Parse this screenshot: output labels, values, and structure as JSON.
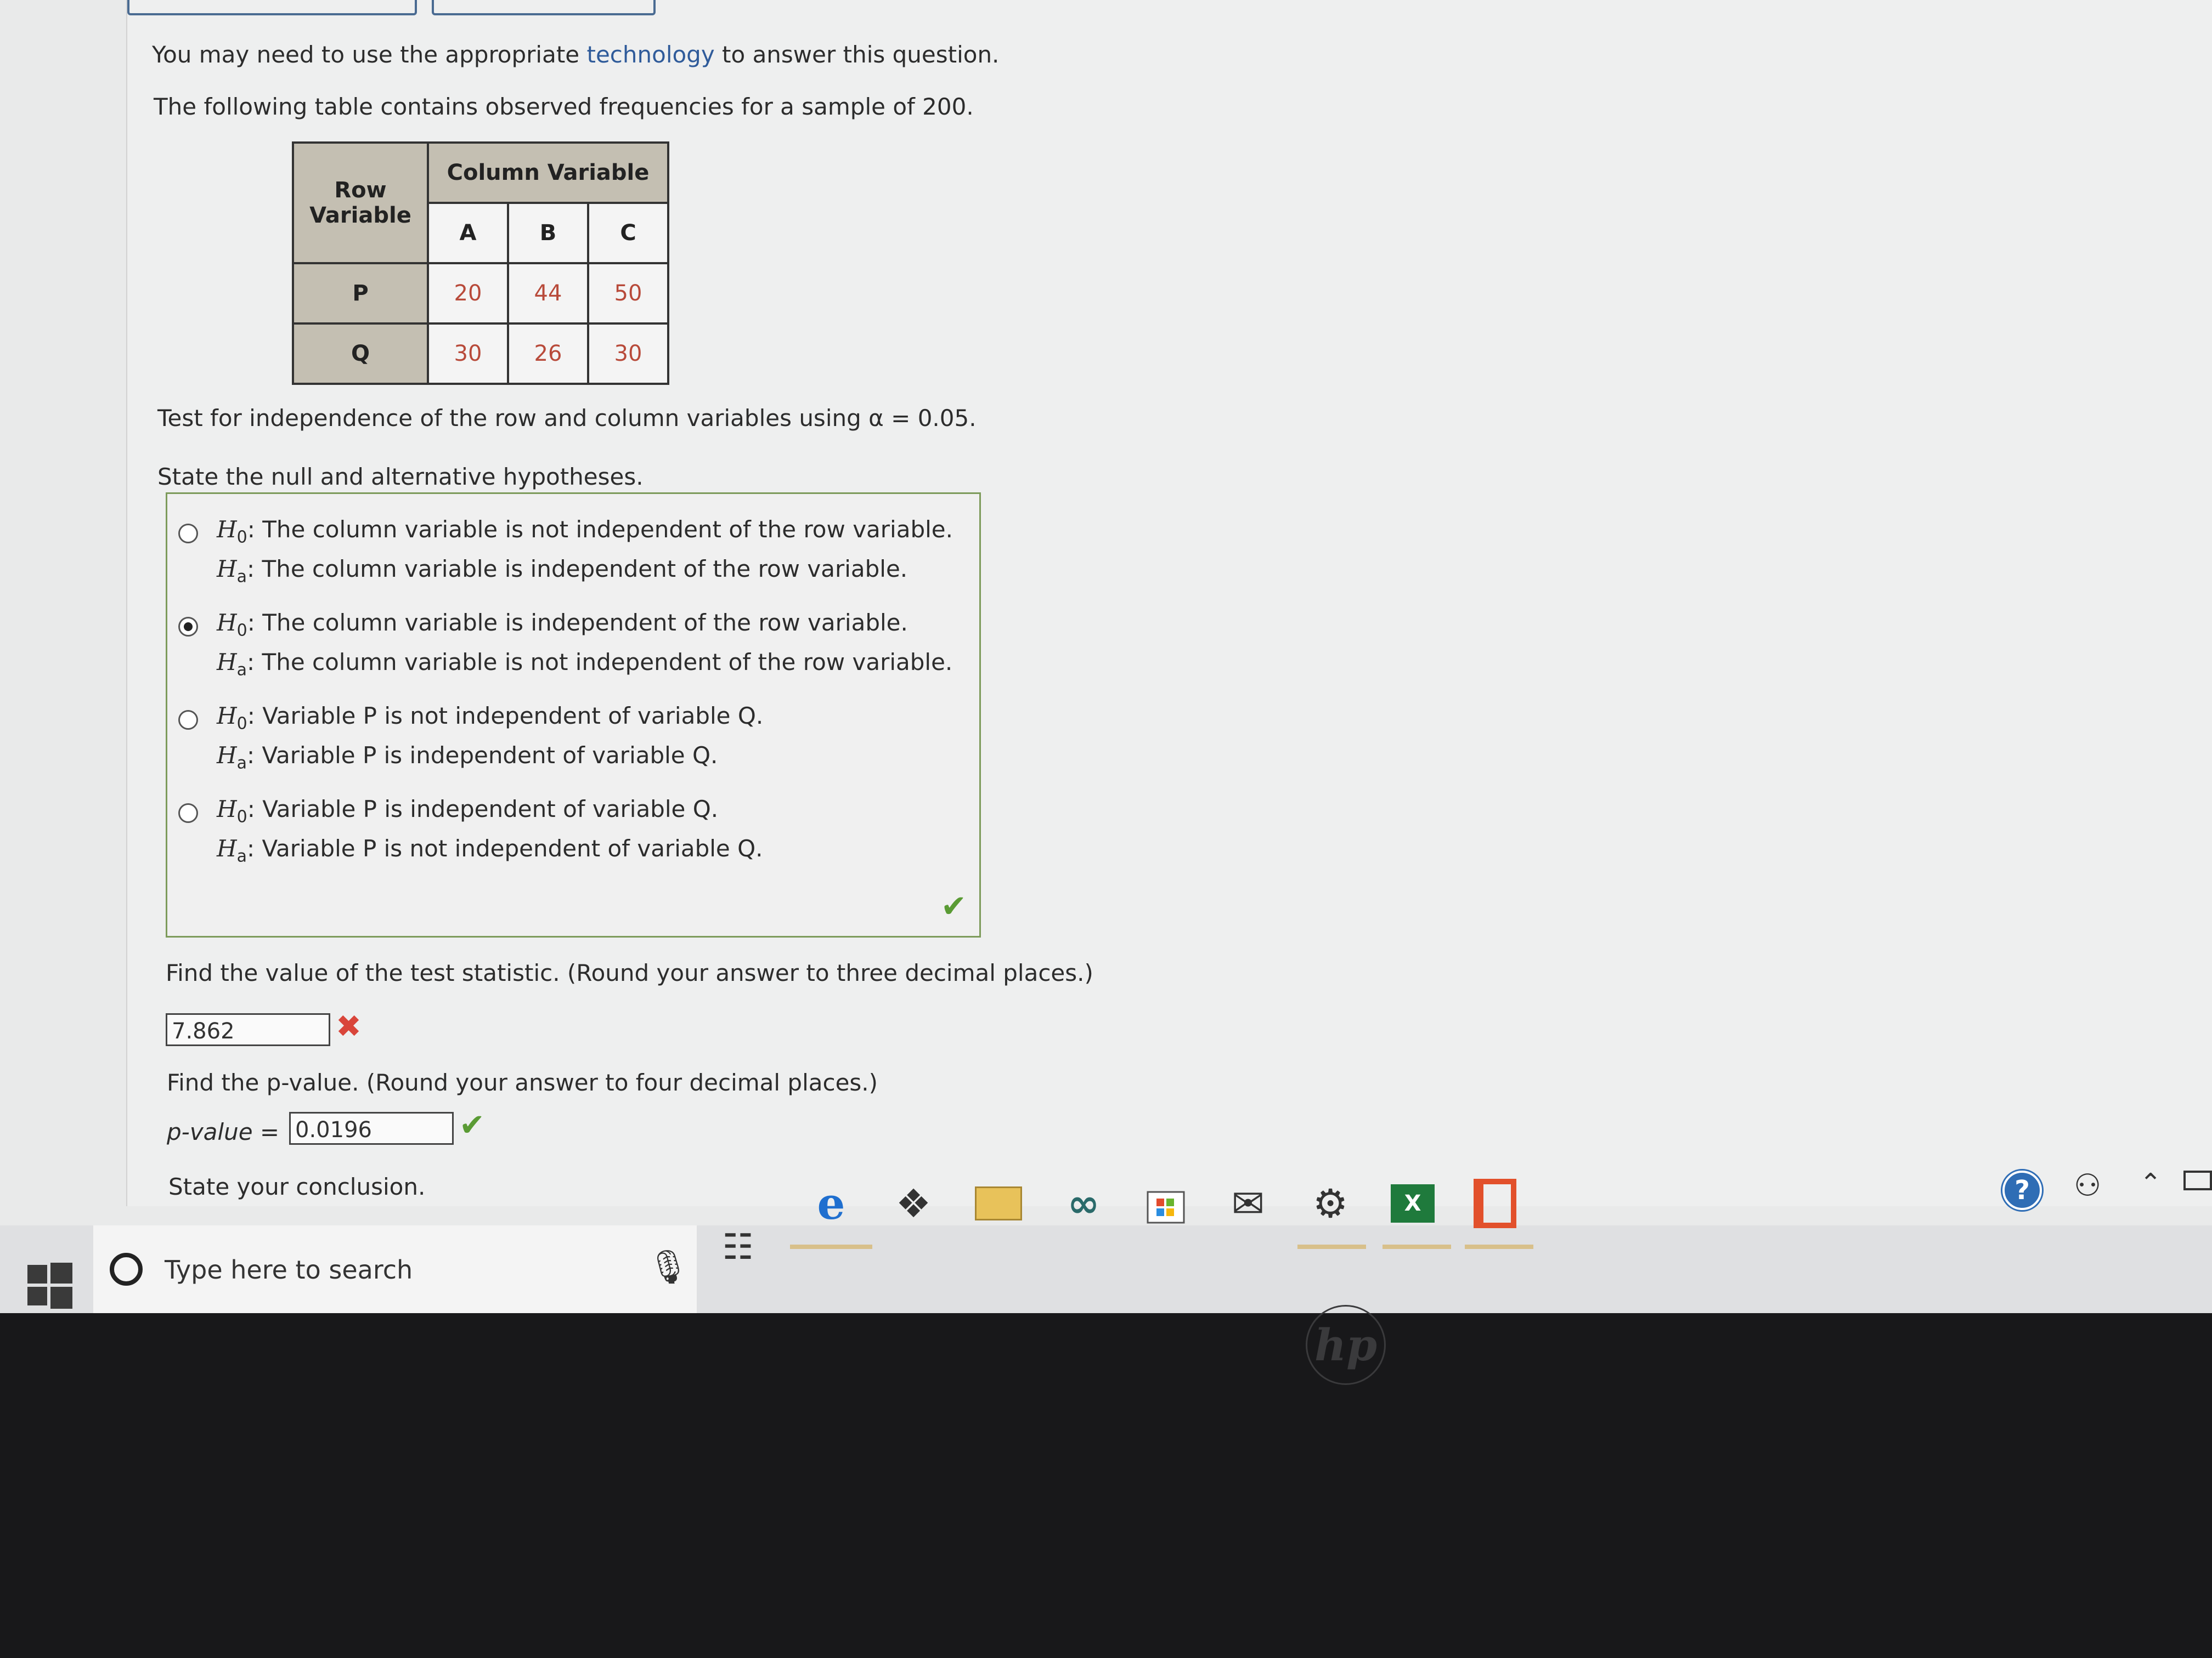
{
  "intro": {
    "prefix": "You may need to use the appropriate ",
    "link": "technology",
    "suffix": " to answer this question."
  },
  "table_intro": "The following table contains observed frequencies for a sample of 200.",
  "table": {
    "row_header": "Row Variable",
    "col_header": "Column Variable",
    "columns": [
      "A",
      "B",
      "C"
    ],
    "rows": [
      {
        "label": "P",
        "values": [
          "20",
          "44",
          "50"
        ]
      },
      {
        "label": "Q",
        "values": [
          "30",
          "26",
          "30"
        ]
      }
    ]
  },
  "test_text": "Test for independence of the row and column variables using α = 0.05.",
  "hypotheses_prompt": "State the null and alternative hypotheses.",
  "options": [
    {
      "h0": "The column variable is not independent of the row variable.",
      "ha": "The column variable is independent of the row variable.",
      "selected": false
    },
    {
      "h0": "The column variable is independent of the row variable.",
      "ha": "The column variable is not independent of the row variable.",
      "selected": true
    },
    {
      "h0": "Variable P is not independent of variable Q.",
      "ha": "Variable P is independent of variable Q.",
      "selected": false
    },
    {
      "h0": "Variable P is independent of variable Q.",
      "ha": "Variable P is not independent of variable Q.",
      "selected": false
    }
  ],
  "h0_label": "H",
  "h0_sub": "0",
  "ha_sub": "a",
  "test_stat_prompt": "Find the value of the test statistic. (Round your answer to three decimal places.)",
  "test_stat_value": "7.862",
  "pvalue_prompt": "Find the p-value. (Round your answer to four decimal places.)",
  "pvalue_label": "p-value =",
  "pvalue_value": "0.0196",
  "conclusion_prompt": "State your conclusion.",
  "taskbar": {
    "search_placeholder": "Type here to search",
    "icons": [
      "microphone-icon",
      "task-view-icon",
      "edge-icon",
      "dropbox-icon",
      "file-explorer-icon",
      "infinity-app-icon",
      "store-icon",
      "mail-icon",
      "settings-icon",
      "excel-icon",
      "office-icon"
    ],
    "excel_letter": "X"
  },
  "colors": {
    "correct": "#5a9b34",
    "incorrect": "#d9453a",
    "table_header_bg": "#c4bfb2",
    "table_values": "#b84a3a",
    "link": "#2f5b9a"
  },
  "bezel_logo": "hp"
}
